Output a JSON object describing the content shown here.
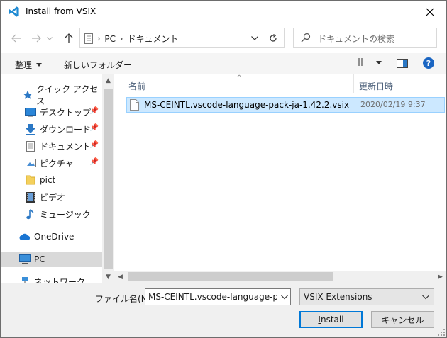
{
  "window": {
    "title": "Install from VSIX"
  },
  "address": {
    "crumbs": [
      "PC",
      "ドキュメント"
    ]
  },
  "search": {
    "placeholder": "ドキュメントの検索"
  },
  "toolbar": {
    "organize_label": "整理",
    "new_folder_label": "新しいフォルダー"
  },
  "sidebar": {
    "quick_access_label": "クイック アクセス",
    "items": [
      {
        "label": "デスクトップ",
        "pinned": true,
        "icon": "desktop-icon"
      },
      {
        "label": "ダウンロード",
        "pinned": true,
        "icon": "download-icon"
      },
      {
        "label": "ドキュメント",
        "pinned": true,
        "icon": "document-icon"
      },
      {
        "label": "ピクチャ",
        "pinned": true,
        "icon": "pictures-icon"
      },
      {
        "label": "pict",
        "pinned": false,
        "icon": "folder-icon"
      },
      {
        "label": "ビデオ",
        "pinned": false,
        "icon": "video-icon"
      },
      {
        "label": "ミュージック",
        "pinned": false,
        "icon": "music-icon"
      }
    ],
    "onedrive_label": "OneDrive",
    "pc_label": "PC",
    "network_label": "ネットワーク"
  },
  "columns": {
    "name": "名前",
    "date": "更新日時"
  },
  "files": [
    {
      "name": "MS-CEINTL.vscode-language-pack-ja-1.42.2.vsix",
      "modified": "2020/02/19 9:37",
      "selected": true
    }
  ],
  "footer": {
    "filename_label": "ファイル名(",
    "filename_accel": "N",
    "filename_label_end": "):",
    "filename_value": "MS-CEINTL.vscode-language-pack",
    "filetype_value": "VSIX Extensions",
    "install_label": "Install",
    "install_accel": "I",
    "install_rest": "nstall",
    "cancel_label": "キャンセル"
  },
  "colors": {
    "selection_bg": "#cce8ff",
    "selection_border": "#99d1ff",
    "accent": "#0078d7",
    "vscode_blue": "#1f8ad2"
  }
}
